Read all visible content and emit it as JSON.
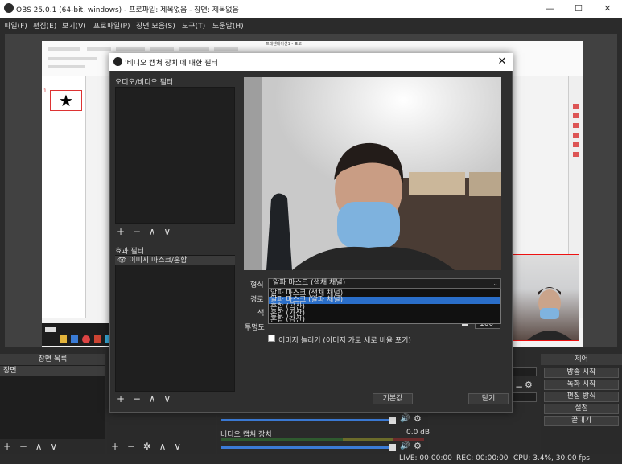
{
  "window": {
    "title": "OBS 25.0.1 (64-bit, windows) - 프로파일: 제목없음 - 장면: 제목없음",
    "minimize": "—",
    "maximize": "☐",
    "close": "✕"
  },
  "menu": [
    "파일(F)",
    "편집(E)",
    "보기(V)",
    "프로파일(P)",
    "장면 모음(S)",
    "도구(T)",
    "도움말(H)"
  ],
  "preview": {
    "desktop_title": "프레젠테이션1 - 표고",
    "slide_number": "1",
    "slide_glyph": "★"
  },
  "docks": {
    "scenes": {
      "title": "장면 목록",
      "items": [
        "장면"
      ],
      "buttons": "+ − ∧ ∨"
    },
    "sources": {
      "buttons": "+ − ✲ ∧ ∨"
    },
    "mixer": {
      "track_name": "비디오 캡쳐 장치",
      "track_level": "0.0 dB"
    },
    "controls": {
      "title": "제어",
      "buttons": [
        "방송 시작",
        "녹화 시작",
        "편집 방식",
        "설정",
        "끝내기"
      ]
    }
  },
  "status": {
    "live": "LIVE: 00:00:00",
    "rec": "REC: 00:00:00",
    "cpu": "CPU: 3.4%, 30.00 fps"
  },
  "dialog": {
    "title": "'비디오 캡쳐 장치'에 대한 필터",
    "close": "✕",
    "av_filters_label": "오디오/비디오 필터",
    "effect_filters_label": "효과 필터",
    "effect_filters": [
      {
        "name": "이미지 마스크/혼합",
        "visible_icon": "eye-icon"
      }
    ],
    "list_buttons": "+ − ∧ ∨",
    "settings": {
      "type_label": "형식",
      "path_label": "경로",
      "color_label": "색",
      "opacity_label": "투명도",
      "opacity_value": "100",
      "type_value": "알파 마스크 (색채 채널)",
      "type_options": [
        "알파 마스크 (색채 채널)",
        "알파 마스크 (알파 채널)",
        "혼합 (곱산)",
        "혼합 (가산)",
        "혼합 (감산)"
      ],
      "selected_option_index": 1,
      "stretch_label": "이미지 늘리기 (이미지 가로 세로 비율 포기)",
      "stretch_checked": false
    },
    "defaults_button": "기본값",
    "close_button": "닫기"
  },
  "colors": {
    "obs_bg": "#2b2b2b",
    "selection": "#2a6ec9",
    "fader": "#3b7bd6",
    "crop_outline": "#e11111"
  }
}
